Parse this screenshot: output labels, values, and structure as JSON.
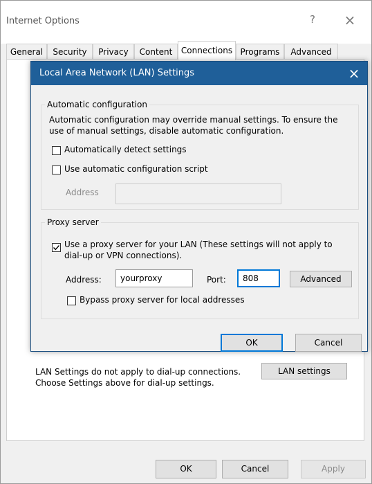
{
  "window": {
    "title": "Internet Options",
    "help_label": "?",
    "close_label": "×"
  },
  "tabs": [
    {
      "label": "General"
    },
    {
      "label": "Security"
    },
    {
      "label": "Privacy"
    },
    {
      "label": "Content"
    },
    {
      "label": "Connections",
      "active": true
    },
    {
      "label": "Programs"
    },
    {
      "label": "Advanced"
    }
  ],
  "connections_panel": {
    "lan_note_line1": "LAN Settings do not apply to dial-up connections.",
    "lan_note_line2": "Choose Settings above for dial-up settings.",
    "lan_settings_button": "LAN settings"
  },
  "footer": {
    "ok": "OK",
    "cancel": "Cancel",
    "apply": "Apply"
  },
  "dialog": {
    "title": "Local Area Network (LAN) Settings",
    "close_label": "×",
    "auto_config": {
      "group_label": "Automatic configuration",
      "description_line1": "Automatic configuration may override manual settings.  To ensure the",
      "description_line2": "use of manual settings, disable automatic configuration.",
      "auto_detect_label": "Automatically detect settings",
      "auto_detect_checked": false,
      "script_label": "Use automatic configuration script",
      "script_checked": false,
      "address_label": "Address",
      "address_value": ""
    },
    "proxy": {
      "group_label": "Proxy server",
      "use_proxy_line1": "Use a proxy server for your LAN (These settings will not apply to",
      "use_proxy_line2": "dial-up or VPN connections).",
      "use_proxy_checked": true,
      "address_label": "Address:",
      "address_value": "yourproxy",
      "port_label": "Port:",
      "port_value": "808",
      "advanced_button": "Advanced",
      "bypass_label": "Bypass proxy server for local addresses",
      "bypass_checked": false
    },
    "ok": "OK",
    "cancel": "Cancel"
  },
  "colors": {
    "dialog_titlebar": "#1f5f99",
    "default_button_border": "#0078d7"
  }
}
